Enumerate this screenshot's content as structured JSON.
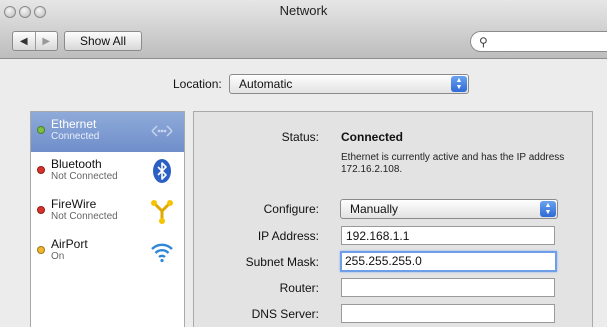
{
  "window": {
    "title": "Network"
  },
  "toolbar": {
    "back_glyph": "◀",
    "forward_glyph": "▶",
    "show_all_label": "Show All",
    "search_placeholder": "",
    "search_icon_glyph": "⚲"
  },
  "location": {
    "label": "Location:",
    "value": "Automatic"
  },
  "sidebar": {
    "services": [
      {
        "name": "Ethernet",
        "status": "Connected",
        "status_color": "#7bc043",
        "icon": "ethernet-icon",
        "selected": true
      },
      {
        "name": "Bluetooth",
        "status": "Not Connected",
        "status_color": "#d8322a",
        "icon": "bluetooth-icon",
        "selected": false
      },
      {
        "name": "FireWire",
        "status": "Not Connected",
        "status_color": "#d8322a",
        "icon": "firewire-icon",
        "selected": false
      },
      {
        "name": "AirPort",
        "status": "On",
        "status_color": "#f3b62a",
        "icon": "wifi-icon",
        "selected": false
      }
    ]
  },
  "detail": {
    "status_label": "Status:",
    "status_value": "Connected",
    "status_description": "Ethernet is currently active and has the IP address 172.16.2.108.",
    "configure_label": "Configure:",
    "configure_value": "Manually",
    "ip_label": "IP Address:",
    "ip_value": "192.168.1.1",
    "subnet_label": "Subnet Mask:",
    "subnet_value": "255.255.255.0",
    "router_label": "Router:",
    "router_value": "",
    "dns_label": "DNS Server:",
    "dns_value": ""
  },
  "colors": {
    "selection": "#7c98d0",
    "focus_ring": "#6f9ee9",
    "popup_stepper": "#3f7be0"
  }
}
